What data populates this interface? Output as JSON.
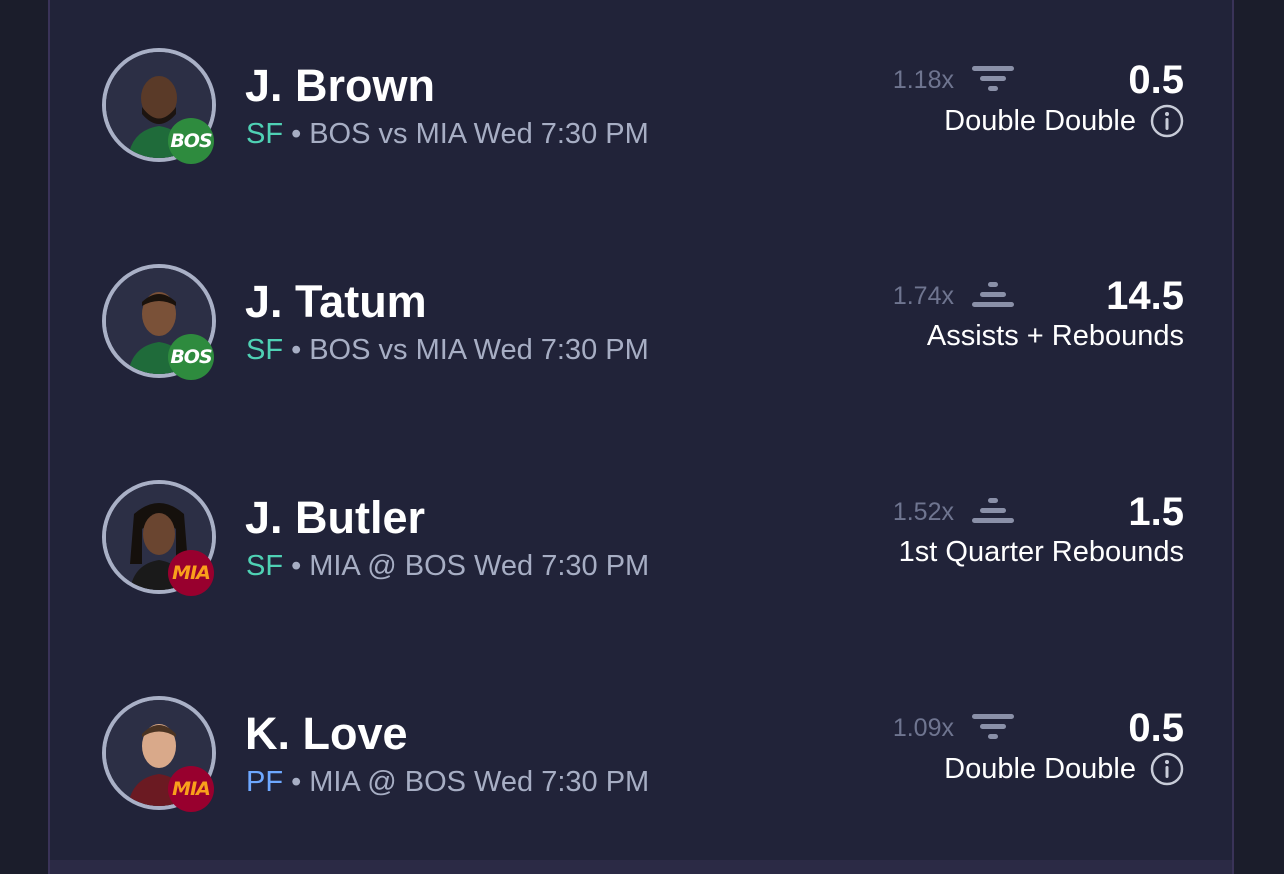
{
  "colors": {
    "background": "#1b1d2b",
    "panel": "#212339",
    "position_sf": "#4fd1b4",
    "position_pf": "#6ea8ff",
    "bos_badge": "#2e8b3e",
    "bos_text": "#ffffff",
    "mia_badge": "#98002e",
    "mia_text": "#f9a01b"
  },
  "players": [
    {
      "name": "J. Brown",
      "position": "SF",
      "separator": "•",
      "matchup": "BOS vs MIA Wed 7:30 PM",
      "team_abbr": "BOS",
      "multiplier": "1.18x",
      "trend_icon": "filter-down-icon",
      "line": "0.5",
      "stat": "Double Double",
      "has_info": true
    },
    {
      "name": "J. Tatum",
      "position": "SF",
      "separator": "•",
      "matchup": "BOS vs MIA Wed 7:30 PM",
      "team_abbr": "BOS",
      "multiplier": "1.74x",
      "trend_icon": "stack-up-icon",
      "line": "14.5",
      "stat": "Assists + Rebounds",
      "has_info": false
    },
    {
      "name": "J. Butler",
      "position": "SF",
      "separator": "•",
      "matchup": "MIA @ BOS Wed 7:30 PM",
      "team_abbr": "MIA",
      "multiplier": "1.52x",
      "trend_icon": "stack-up-icon",
      "line": "1.5",
      "stat": "1st Quarter Rebounds",
      "has_info": false
    },
    {
      "name": "K. Love",
      "position": "PF",
      "separator": "•",
      "matchup": "MIA @ BOS Wed 7:30 PM",
      "team_abbr": "MIA",
      "multiplier": "1.09x",
      "trend_icon": "filter-down-icon",
      "line": "0.5",
      "stat": "Double Double",
      "has_info": true
    }
  ]
}
